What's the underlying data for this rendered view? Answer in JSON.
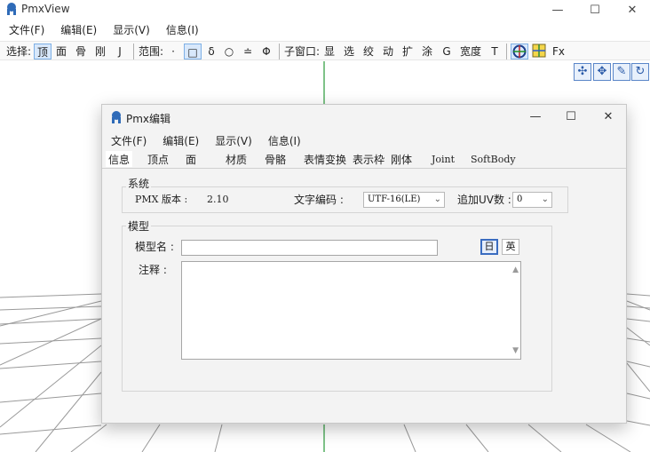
{
  "app": {
    "title": "PmxView",
    "menu": [
      "文件(F)",
      "编辑(E)",
      "显示(V)",
      "信息(I)"
    ],
    "window_controls": {
      "minimize": "—",
      "maximize": "☐",
      "close": "✕"
    }
  },
  "toolbar": {
    "select_label": "选择:",
    "select_items": [
      "顶",
      "面",
      "骨",
      "刚",
      "J"
    ],
    "range_label": "范围:",
    "range_items": [
      "·",
      "□",
      "δ",
      "○",
      "≐",
      "Φ"
    ],
    "subwindow_label": "子窗口:",
    "subwindow_items": [
      "显",
      "选",
      "绞",
      "动",
      "扩",
      "涂",
      "G",
      "宽度",
      "T"
    ],
    "fx_label": "Fx",
    "active_select": "顶",
    "active_range": "□"
  },
  "gizmos": [
    "move-xy",
    "move-xz",
    "rotate-pen",
    "rotate"
  ],
  "dialog": {
    "title": "Pmx编辑",
    "menu": [
      "文件(F)",
      "编辑(E)",
      "显示(V)",
      "信息(I)"
    ],
    "tabs": [
      "信息",
      "顶点",
      "面",
      "材质",
      "骨骼",
      "表情变换",
      "表示枠",
      "刚体",
      "Joint",
      "SoftBody"
    ],
    "selected_tab": "信息",
    "system": {
      "group_label": "系统",
      "pmx_label": "PMX 版本 :",
      "version": "2.10",
      "encoding_label": "文字编码 :",
      "encoding_value": "UTF-16(LE)",
      "uv_label": "追加UV数 :",
      "uv_value": "0"
    },
    "model": {
      "group_label": "模型",
      "name_label": "模型名 :",
      "name_value": "",
      "comment_label": "注释 :",
      "comment_value": "",
      "lang_jp": "日",
      "lang_en": "英"
    }
  }
}
